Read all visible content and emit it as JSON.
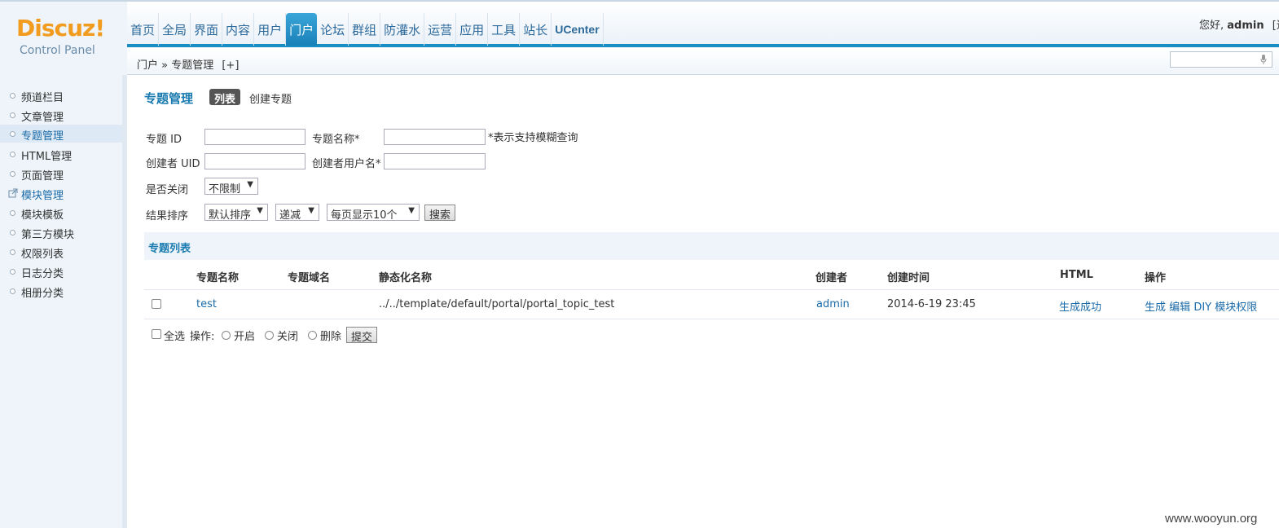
{
  "logo": {
    "brand": "Discuz!",
    "subtitle": "Control Panel"
  },
  "nav": {
    "items": [
      "首页",
      "全局",
      "界面",
      "内容",
      "用户",
      "门户",
      "论坛",
      "群组",
      "防灌水",
      "运营",
      "应用",
      "工具",
      "站长",
      "UCenter"
    ],
    "active": "门户"
  },
  "header": {
    "greeting_prefix": "您好,",
    "username": "admin",
    "greeting_suffix": "[退"
  },
  "breadcrumb": {
    "text": "门户 » 专题管理",
    "add": "[+]"
  },
  "sidebar": {
    "items": [
      "频道栏目",
      "文章管理",
      "专题管理",
      "HTML管理",
      "页面管理",
      "模块管理",
      "模块模板",
      "第三方模块",
      "权限列表",
      "日志分类",
      "相册分类"
    ]
  },
  "page": {
    "title": "专题管理",
    "tab_list": "列表",
    "tab_create": "创建专题"
  },
  "form": {
    "topic_id_label": "专题 ID",
    "topic_name_label": "专题名称*",
    "fuzzy_note": "*表示支持模糊查询",
    "creator_uid_label": "创建者 UID",
    "creator_name_label": "创建者用户名*",
    "closed_label": "是否关闭",
    "closed_value": "不限制",
    "sort_label": "结果排序",
    "sort_value": "默认排序",
    "order_value": "递减",
    "perpage_value": "每页显示10个",
    "search_button": "搜索"
  },
  "list": {
    "title": "专题列表",
    "columns": [
      "专题名称",
      "专题域名",
      "静态化名称",
      "创建者",
      "创建时间",
      "HTML",
      "操作"
    ],
    "rows": [
      {
        "name": "test",
        "domain": "",
        "static_name": "../../template/default/portal/portal_topic_test",
        "creator": "admin",
        "created": "2014-6-19 23:45",
        "html": "生成成功",
        "actions": [
          "生成",
          "编辑",
          "DIY",
          "模块",
          "权限"
        ]
      }
    ]
  },
  "footer_actions": {
    "select_all": "全选",
    "operation_label": "操作:",
    "open": "开启",
    "close": "关闭",
    "delete": "删除",
    "submit": "提交"
  },
  "watermark": "www.wooyun.org"
}
